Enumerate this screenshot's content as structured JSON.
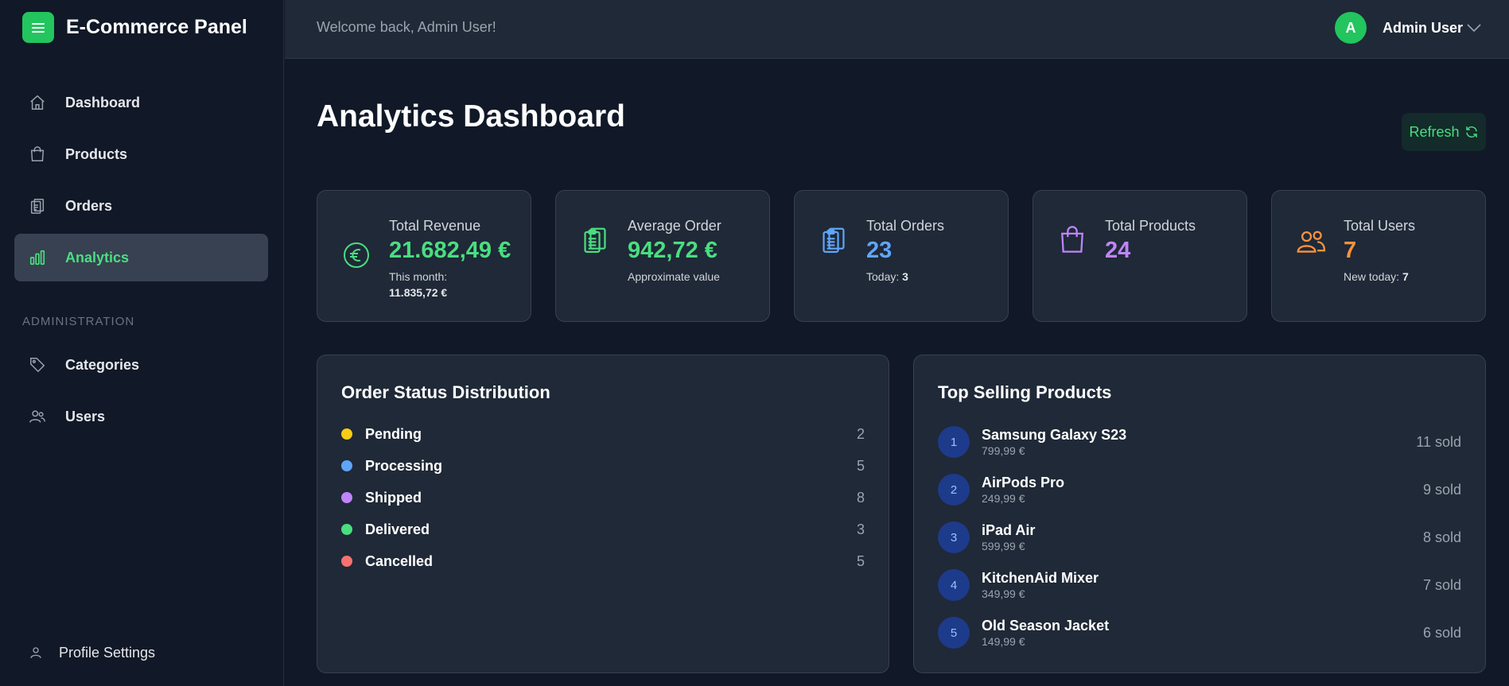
{
  "sidebar": {
    "brand_title": "E-Commerce Panel",
    "brand_icon": "menu-icon",
    "main_items": [
      {
        "label": "Dashboard",
        "icon": "home-icon"
      },
      {
        "label": "Products",
        "icon": "shopping-bag-icon"
      },
      {
        "label": "Orders",
        "icon": "clipboard-icon"
      },
      {
        "label": "Analytics",
        "icon": "bar-chart-icon",
        "active": true
      }
    ],
    "section_title": "ADMINISTRATION",
    "admin_items": [
      {
        "label": "Categories",
        "icon": "tag-icon"
      },
      {
        "label": "Users",
        "icon": "users-icon"
      }
    ],
    "profile_label": "Profile Settings"
  },
  "header": {
    "welcome": "Welcome back, Admin User!",
    "avatar_initial": "A",
    "user_name": "Admin User"
  },
  "page": {
    "title": "Analytics Dashboard",
    "refresh_label": "Refresh"
  },
  "stats": [
    {
      "label": "Total Revenue",
      "value": "21.682,49 €",
      "sub_prefix": "This month:",
      "sub_value": "11.835,72 €",
      "color": "#4ade80",
      "icon": "euro-icon"
    },
    {
      "label": "Average Order",
      "value": "942,72 €",
      "sub_prefix": "Approximate value",
      "sub_value": "",
      "color": "#4ade80",
      "icon": "clipboard-icon"
    },
    {
      "label": "Total Orders",
      "value": "23",
      "sub_prefix": "Today:",
      "sub_value": "3",
      "color": "#60a5fa",
      "icon": "clipboard-icon"
    },
    {
      "label": "Total Products",
      "value": "24",
      "sub_prefix": "",
      "sub_value": "",
      "color": "#c084fc",
      "icon": "shopping-bag-icon"
    },
    {
      "label": "Total Users",
      "value": "7",
      "sub_prefix": "New today:",
      "sub_value": "7",
      "color": "#fb923c",
      "icon": "users-icon"
    }
  ],
  "order_status": {
    "title": "Order Status Distribution",
    "items": [
      {
        "name": "Pending",
        "count": "2",
        "color": "#facc15"
      },
      {
        "name": "Processing",
        "count": "5",
        "color": "#60a5fa"
      },
      {
        "name": "Shipped",
        "count": "8",
        "color": "#c084fc"
      },
      {
        "name": "Delivered",
        "count": "3",
        "color": "#4ade80"
      },
      {
        "name": "Cancelled",
        "count": "5",
        "color": "#f87171"
      }
    ]
  },
  "top_products": {
    "title": "Top Selling Products",
    "items": [
      {
        "rank": "1",
        "name": "Samsung Galaxy S23",
        "price": "799,99 €",
        "sold": "11 sold"
      },
      {
        "rank": "2",
        "name": "AirPods Pro",
        "price": "249,99 €",
        "sold": "9 sold"
      },
      {
        "rank": "3",
        "name": "iPad Air",
        "price": "599,99 €",
        "sold": "8 sold"
      },
      {
        "rank": "4",
        "name": "KitchenAid Mixer",
        "price": "349,99 €",
        "sold": "7 sold"
      },
      {
        "rank": "5",
        "name": "Old Season Jacket",
        "price": "149,99 €",
        "sold": "6 sold"
      }
    ]
  },
  "colors": {
    "accent": "#22c55e",
    "background": "#111827",
    "card": "#1f2937"
  }
}
